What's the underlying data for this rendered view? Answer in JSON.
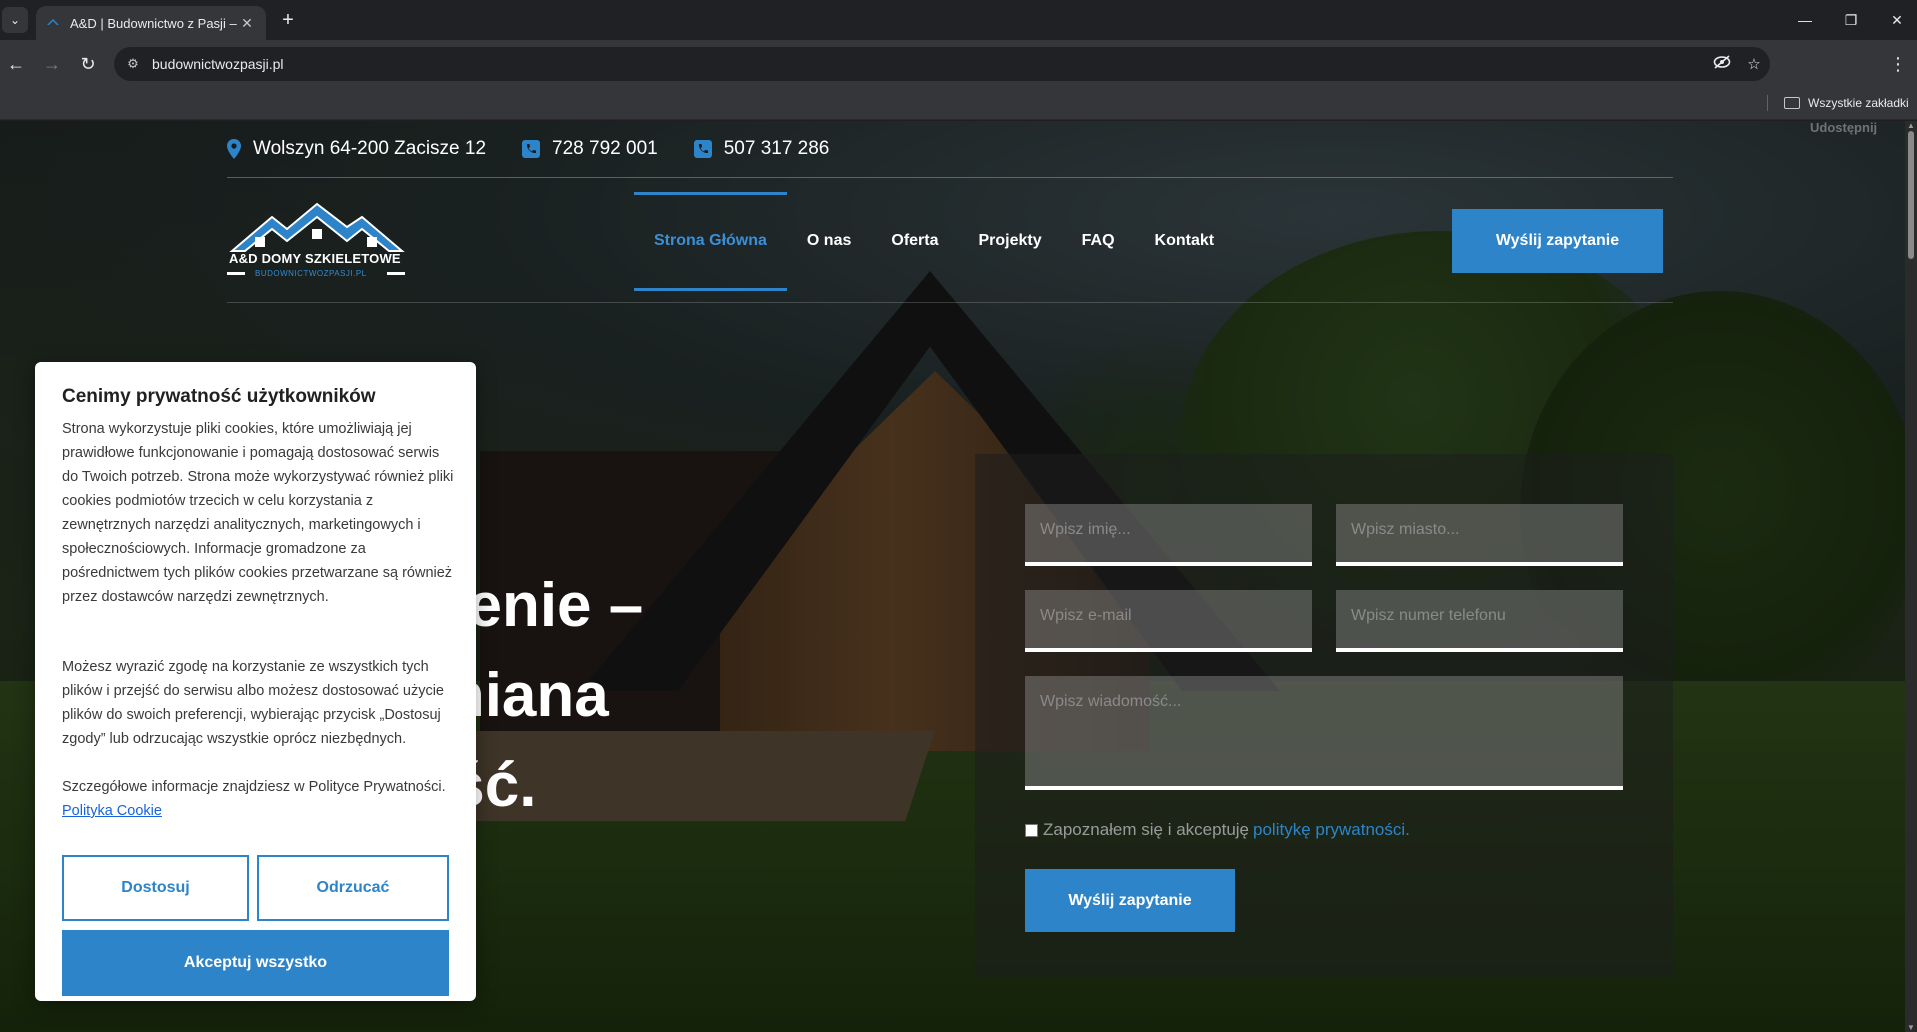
{
  "browser": {
    "tab_title": "A&D | Budownictwo z Pasji – Tw",
    "url": "budownictwozpasji.pl",
    "bookmarks_all": "Wszystkie zakładki",
    "icons": [
      "tab-list-icon",
      "favicon-icon",
      "close-tab-icon",
      "new-tab-icon",
      "minimize-icon",
      "restore-icon",
      "close-window-icon",
      "back-icon",
      "forward-icon",
      "reload-icon",
      "site-info-icon",
      "eye-off-icon",
      "star-icon",
      "kebab-menu-icon",
      "folder-icon"
    ]
  },
  "page": {
    "share": "Udostępnij",
    "topbar": {
      "address": "Wolszyn 64-200 Zacisze 12",
      "phone1": "728 792 001",
      "phone2": "507 317 286"
    },
    "logo": {
      "name": "A&D DOMY SZKIELETOWE",
      "sub": "BUDOWNICTWOZPASJI.PL"
    },
    "nav": [
      "Strona Główna",
      "O nas",
      "Oferta",
      "Projekty",
      "FAQ",
      "Kontakt"
    ],
    "cta_top": "Wyślij zapytanie",
    "hero": {
      "line1": "narzenie –",
      "line2": "rewniana",
      "line3": "istość."
    },
    "form": {
      "name_placeholder": "Wpisz imię...",
      "city_placeholder": "Wpisz miasto...",
      "email_placeholder": "Wpisz e-mail",
      "phone_placeholder": "Wpisz numer telefonu",
      "message_placeholder": "Wpisz wiadomość...",
      "consent": "Zapoznałem się i akceptuję",
      "consent_link": "politykę prywatności.",
      "submit": "Wyślij zapytanie"
    },
    "accent_color": "#2d84c9"
  },
  "cookie": {
    "title": "Cenimy prywatność użytkowników",
    "p1": "Strona wykorzystuje pliki cookies, które umożliwiają jej prawidłowe funkcjonowanie i pomagają dostosować serwis do Twoich potrzeb.  Strona może wykorzystywać również pliki cookies podmiotów trzecich w celu korzystania z zewnętrznych narzędzi analitycznych, marketingowych i społecznościowych. Informacje gromadzone za pośrednictwem tych plików cookies przetwarzane są również przez dostawców narzędzi zewnętrznych.",
    "p2": "Możesz wyrazić zgodę na korzystanie ze wszystkich tych plików i przejść do serwisu albo możesz dostosować użycie plików do swoich preferencji, wybierając przycisk „Dostosuj zgody” lub odrzucając wszystkie oprócz niezbędnych.",
    "p3": "Szczegółowe informacje znajdziesz w Polityce Prywatności.",
    "p3_link": "Polityka Cookie",
    "btn_customize": "Dostosuj",
    "btn_reject": "Odrzucać",
    "btn_accept": "Akceptuj wszystko"
  }
}
